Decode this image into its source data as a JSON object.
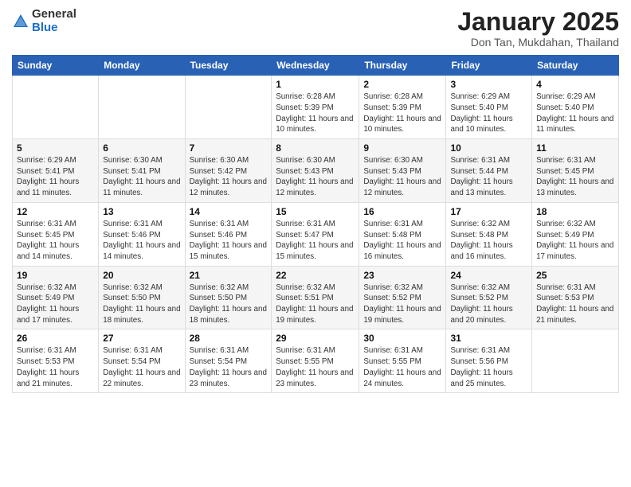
{
  "logo": {
    "general": "General",
    "blue": "Blue"
  },
  "header": {
    "month": "January 2025",
    "location": "Don Tan, Mukdahan, Thailand"
  },
  "weekdays": [
    "Sunday",
    "Monday",
    "Tuesday",
    "Wednesday",
    "Thursday",
    "Friday",
    "Saturday"
  ],
  "weeks": [
    [
      {
        "day": "",
        "info": ""
      },
      {
        "day": "",
        "info": ""
      },
      {
        "day": "",
        "info": ""
      },
      {
        "day": "1",
        "info": "Sunrise: 6:28 AM\nSunset: 5:39 PM\nDaylight: 11 hours and 10 minutes."
      },
      {
        "day": "2",
        "info": "Sunrise: 6:28 AM\nSunset: 5:39 PM\nDaylight: 11 hours and 10 minutes."
      },
      {
        "day": "3",
        "info": "Sunrise: 6:29 AM\nSunset: 5:40 PM\nDaylight: 11 hours and 10 minutes."
      },
      {
        "day": "4",
        "info": "Sunrise: 6:29 AM\nSunset: 5:40 PM\nDaylight: 11 hours and 11 minutes."
      }
    ],
    [
      {
        "day": "5",
        "info": "Sunrise: 6:29 AM\nSunset: 5:41 PM\nDaylight: 11 hours and 11 minutes."
      },
      {
        "day": "6",
        "info": "Sunrise: 6:30 AM\nSunset: 5:41 PM\nDaylight: 11 hours and 11 minutes."
      },
      {
        "day": "7",
        "info": "Sunrise: 6:30 AM\nSunset: 5:42 PM\nDaylight: 11 hours and 12 minutes."
      },
      {
        "day": "8",
        "info": "Sunrise: 6:30 AM\nSunset: 5:43 PM\nDaylight: 11 hours and 12 minutes."
      },
      {
        "day": "9",
        "info": "Sunrise: 6:30 AM\nSunset: 5:43 PM\nDaylight: 11 hours and 12 minutes."
      },
      {
        "day": "10",
        "info": "Sunrise: 6:31 AM\nSunset: 5:44 PM\nDaylight: 11 hours and 13 minutes."
      },
      {
        "day": "11",
        "info": "Sunrise: 6:31 AM\nSunset: 5:45 PM\nDaylight: 11 hours and 13 minutes."
      }
    ],
    [
      {
        "day": "12",
        "info": "Sunrise: 6:31 AM\nSunset: 5:45 PM\nDaylight: 11 hours and 14 minutes."
      },
      {
        "day": "13",
        "info": "Sunrise: 6:31 AM\nSunset: 5:46 PM\nDaylight: 11 hours and 14 minutes."
      },
      {
        "day": "14",
        "info": "Sunrise: 6:31 AM\nSunset: 5:46 PM\nDaylight: 11 hours and 15 minutes."
      },
      {
        "day": "15",
        "info": "Sunrise: 6:31 AM\nSunset: 5:47 PM\nDaylight: 11 hours and 15 minutes."
      },
      {
        "day": "16",
        "info": "Sunrise: 6:31 AM\nSunset: 5:48 PM\nDaylight: 11 hours and 16 minutes."
      },
      {
        "day": "17",
        "info": "Sunrise: 6:32 AM\nSunset: 5:48 PM\nDaylight: 11 hours and 16 minutes."
      },
      {
        "day": "18",
        "info": "Sunrise: 6:32 AM\nSunset: 5:49 PM\nDaylight: 11 hours and 17 minutes."
      }
    ],
    [
      {
        "day": "19",
        "info": "Sunrise: 6:32 AM\nSunset: 5:49 PM\nDaylight: 11 hours and 17 minutes."
      },
      {
        "day": "20",
        "info": "Sunrise: 6:32 AM\nSunset: 5:50 PM\nDaylight: 11 hours and 18 minutes."
      },
      {
        "day": "21",
        "info": "Sunrise: 6:32 AM\nSunset: 5:50 PM\nDaylight: 11 hours and 18 minutes."
      },
      {
        "day": "22",
        "info": "Sunrise: 6:32 AM\nSunset: 5:51 PM\nDaylight: 11 hours and 19 minutes."
      },
      {
        "day": "23",
        "info": "Sunrise: 6:32 AM\nSunset: 5:52 PM\nDaylight: 11 hours and 19 minutes."
      },
      {
        "day": "24",
        "info": "Sunrise: 6:32 AM\nSunset: 5:52 PM\nDaylight: 11 hours and 20 minutes."
      },
      {
        "day": "25",
        "info": "Sunrise: 6:31 AM\nSunset: 5:53 PM\nDaylight: 11 hours and 21 minutes."
      }
    ],
    [
      {
        "day": "26",
        "info": "Sunrise: 6:31 AM\nSunset: 5:53 PM\nDaylight: 11 hours and 21 minutes."
      },
      {
        "day": "27",
        "info": "Sunrise: 6:31 AM\nSunset: 5:54 PM\nDaylight: 11 hours and 22 minutes."
      },
      {
        "day": "28",
        "info": "Sunrise: 6:31 AM\nSunset: 5:54 PM\nDaylight: 11 hours and 23 minutes."
      },
      {
        "day": "29",
        "info": "Sunrise: 6:31 AM\nSunset: 5:55 PM\nDaylight: 11 hours and 23 minutes."
      },
      {
        "day": "30",
        "info": "Sunrise: 6:31 AM\nSunset: 5:55 PM\nDaylight: 11 hours and 24 minutes."
      },
      {
        "day": "31",
        "info": "Sunrise: 6:31 AM\nSunset: 5:56 PM\nDaylight: 11 hours and 25 minutes."
      },
      {
        "day": "",
        "info": ""
      }
    ]
  ]
}
